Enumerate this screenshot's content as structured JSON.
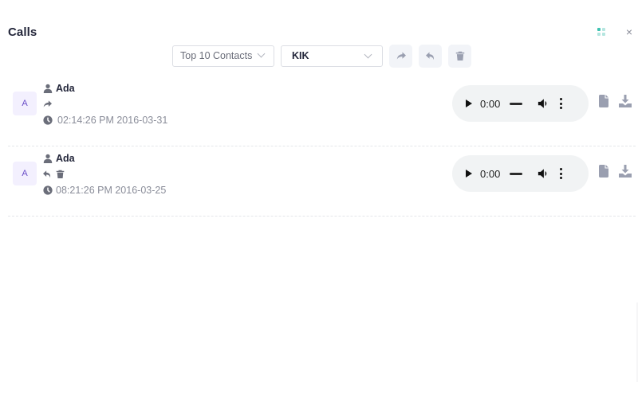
{
  "header": {
    "title": "Calls",
    "layout_icon": "grid-icon",
    "close_icon": "close-icon",
    "close_glyph": "×"
  },
  "toolbar": {
    "contacts_select": {
      "value": "Top 10 Contacts"
    },
    "app_select": {
      "value": "KIK"
    },
    "buttons": [
      {
        "name": "outgoing-filter-button",
        "icon": "share-forward-icon"
      },
      {
        "name": "incoming-filter-button",
        "icon": "reply-icon"
      },
      {
        "name": "deleted-filter-button",
        "icon": "trash-icon"
      }
    ]
  },
  "colors": {
    "accent_teal": "#3fc3b2",
    "avatar_bg": "#f3f0fe",
    "avatar_text": "#6a4ec8",
    "icon_gray": "#9a9fb0",
    "player_bg": "#f1f3f4"
  },
  "calls": [
    {
      "avatar_letter": "A",
      "contact": "Ada",
      "direction": "outgoing",
      "direction_icon": "share-forward-icon",
      "deleted": false,
      "timestamp": "02:14:26 PM 2016-03-31",
      "player_time": "0:00"
    },
    {
      "avatar_letter": "A",
      "contact": "Ada",
      "direction": "incoming",
      "direction_icon": "reply-icon",
      "deleted": true,
      "timestamp": "08:21:26 PM 2016-03-25",
      "player_time": "0:00"
    }
  ]
}
